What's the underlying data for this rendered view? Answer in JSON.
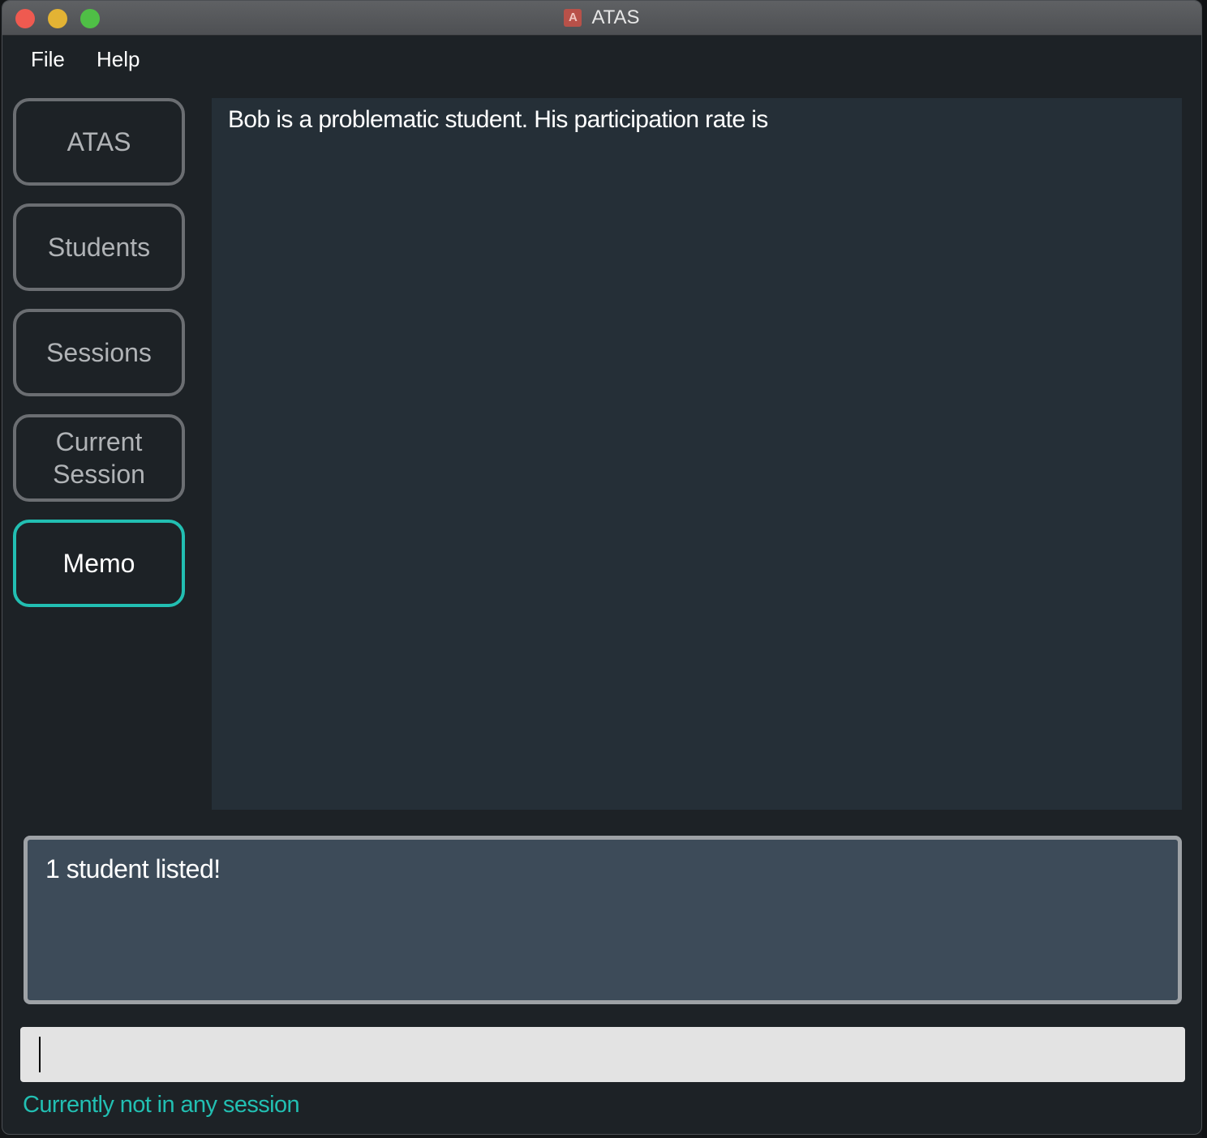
{
  "window": {
    "title": "ATAS",
    "app_icon_letter": "A"
  },
  "menu": {
    "file": "File",
    "help": "Help"
  },
  "sidebar": {
    "items": [
      {
        "label": "ATAS",
        "active": false
      },
      {
        "label": "Students",
        "active": false
      },
      {
        "label": "Sessions",
        "active": false
      },
      {
        "label": "Current Session",
        "active": false
      },
      {
        "label": "Memo",
        "active": true
      }
    ]
  },
  "memo": {
    "content": "Bob is a problematic student. His participation rate is"
  },
  "result": {
    "message": "1 student listed!"
  },
  "command": {
    "value": "",
    "placeholder": ""
  },
  "status": {
    "session": "Currently not in any session"
  },
  "colors": {
    "accent": "#22bfb2",
    "background": "#1d2226",
    "memo_panel": "#252f37",
    "result_panel": "#3d4b59",
    "input": "#e3e3e3"
  }
}
